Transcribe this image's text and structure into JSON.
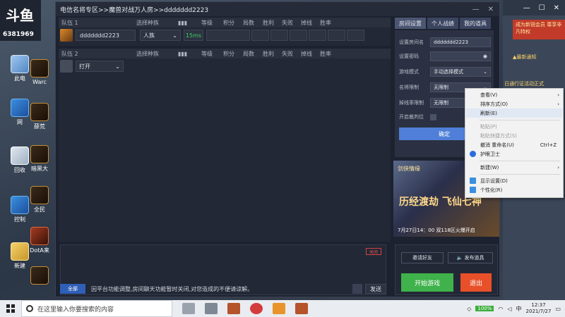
{
  "desktop": {
    "logo_text": "斗鱼",
    "logo_number": "6381969",
    "icons": [
      {
        "label": "此电",
        "kind": "pc"
      },
      {
        "label": "Warc",
        "kind": "game"
      },
      {
        "label": "网",
        "kind": "win"
      },
      {
        "label": "薛荒",
        "kind": "game"
      },
      {
        "label": "回收",
        "kind": "rec"
      },
      {
        "label": "暗黑大",
        "kind": "game"
      },
      {
        "label": "控制",
        "kind": "win"
      },
      {
        "label": "全民",
        "kind": "game"
      },
      {
        "label": "新建",
        "kind": "doc"
      },
      {
        "label": "DotA来",
        "kind": "dota"
      }
    ]
  },
  "app": {
    "title": "电信名将专区>>魔兽对战万人房>>ddddddd2223",
    "team1": {
      "label": "队伍 1",
      "columns": [
        "选择种族",
        "等级",
        "积分",
        "局数",
        "胜利",
        "失败",
        "掉线",
        "胜率"
      ],
      "player": {
        "name": "ddddddd2223",
        "race": "人族",
        "ping": "15ms"
      }
    },
    "team2": {
      "label": "队伍 2",
      "columns": [
        "选择种族",
        "等级",
        "积分",
        "局数",
        "胜利",
        "失败",
        "掉线",
        "胜率"
      ],
      "slot": {
        "state": "打开"
      }
    },
    "tabs": [
      "房间设置",
      "个人战绩",
      "我的道具"
    ],
    "settings": {
      "room_name_label": "设置房间名",
      "room_name": "ddddddd2223",
      "password_label": "设置密码",
      "password": "",
      "mode_label": "游戏模式",
      "mode": "手动选择模式",
      "level_label": "名将限制",
      "level": "无限制",
      "drop_label": "掉线率限制",
      "drop": "无限制",
      "observer_label": "开启裁判位",
      "confirm": "确定"
    },
    "banner": {
      "title": "历经渡劫 飞仙七神",
      "brand": "剑侠情缘",
      "date": "7月27日14：00",
      "extra": "双118区火爆开启"
    },
    "chat": {
      "close_label": "关闭",
      "scope": "全部",
      "message": "因平台功能调整,房间聊天功能暂时关闭,对您造成的不便请谅解。",
      "send": "发送"
    },
    "actions": {
      "invite": "邀请好友",
      "broadcast": "发布道具",
      "start": "开始游戏",
      "exit": "退出"
    }
  },
  "ad": {
    "top": "成为新锐会员 尊享非凡特权",
    "notice": "▲最新通知",
    "link": "日通行证活动正式"
  },
  "context_menu": {
    "items": [
      {
        "label": "查看(V)",
        "arrow": "›",
        "disabled": false
      },
      {
        "label": "排序方式(O)",
        "arrow": "›",
        "disabled": false
      },
      {
        "label": "刷新(E)",
        "disabled": false,
        "highlight": true
      },
      {
        "label": "粘贴(P)",
        "disabled": true
      },
      {
        "label": "粘贴快捷方式(S)",
        "disabled": true
      },
      {
        "label": "撤消 重命名(U)",
        "shortcut": "Ctrl+Z",
        "disabled": false
      },
      {
        "label": "护眼卫士",
        "icon": "shield-icon",
        "disabled": false
      },
      {
        "label": "新建(W)",
        "arrow": "›",
        "disabled": false
      },
      {
        "label": "显示设置(D)",
        "icon": "display-icon",
        "disabled": false
      },
      {
        "label": "个性化(R)",
        "icon": "personalize-icon",
        "disabled": false
      }
    ]
  },
  "taskbar": {
    "search_placeholder": "在这里输入你要搜索的内容",
    "battery": "100%",
    "ime": "中",
    "time": "12:37",
    "date": "2021/7/27"
  }
}
